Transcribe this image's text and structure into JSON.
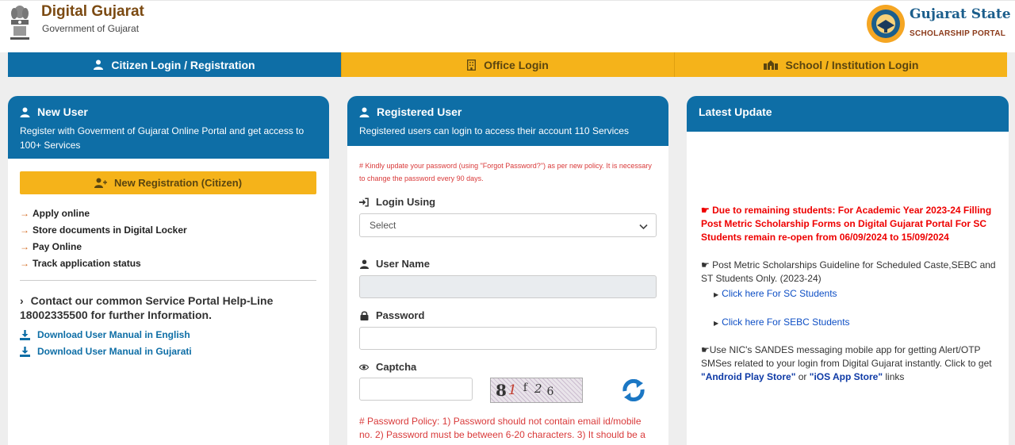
{
  "header": {
    "brand_title": "Digital Gujarat",
    "brand_subtitle": "Government of Gujarat",
    "portal_title": "Gujarat State",
    "portal_subtitle": "SCHOLARSHIP PORTAL"
  },
  "tabs": [
    {
      "label": "Citizen Login / Registration",
      "icon": "user-icon",
      "active": true
    },
    {
      "label": "Office Login",
      "icon": "building-icon",
      "active": false
    },
    {
      "label": "School / Institution Login",
      "icon": "institution-icon",
      "active": false
    }
  ],
  "new_user": {
    "title": "New User",
    "description": "Register with Goverment of Gujarat Online Portal and get access to 100+ Services",
    "register_button": "New Registration (Citizen)",
    "features": [
      "Apply online",
      "Store documents in Digital Locker",
      "Pay Online",
      "Track application status"
    ],
    "helpline": "Contact our common Service Portal Help-Line 18002335500 for further Information.",
    "download_english": "Download User Manual in English",
    "download_gujarati": "Download User Manual in Gujarati"
  },
  "registered_user": {
    "title": "Registered User",
    "description": "Registered users can login to access their account 110 Services",
    "notice": "# Kindly update your password (using \"Forgot Password?\") as per new policy. It is necessary to change the password every 90 days.",
    "login_using_label": "Login Using",
    "login_using_value": "Select",
    "username_label": "User Name",
    "password_label": "Password",
    "captcha_label": "Captcha",
    "captcha_chars": [
      "8",
      "1",
      "f",
      "2",
      "6"
    ],
    "policy": "# Password Policy: 1) Password should not contain email id/mobile no. 2) Password must be between 6-20 characters. 3) It should be a"
  },
  "latest_update": {
    "title": "Latest Update",
    "alert": "Due to remaining students: For Academic Year 2023-24 Filling Post Metric Scholarship Forms on Digital Gujarat Portal For SC Students remain re-open from 06/09/2024 to 15/09/2024",
    "guideline": "Post Metric Scholarships Guideline for Scheduled Caste,SEBC and ST Students Only. (2023-24)",
    "link_sc": "Click here For SC Students",
    "link_sebc": "Click here For SEBC Students",
    "sandes_text": "Use NIC's SANDES messaging mobile app for getting Alert/OTP SMSes related to your login from Digital Gujarat instantly. Click to get",
    "android_store": "\"Android Play Store\"",
    "or_text": "or",
    "ios_store": "\"iOS App Store\"",
    "links_text": "links"
  },
  "colors": {
    "primary_blue": "#0e6ea6",
    "accent_yellow": "#f5b31a",
    "alert_red": "#e00000",
    "brand_brown": "#7b4a12"
  }
}
